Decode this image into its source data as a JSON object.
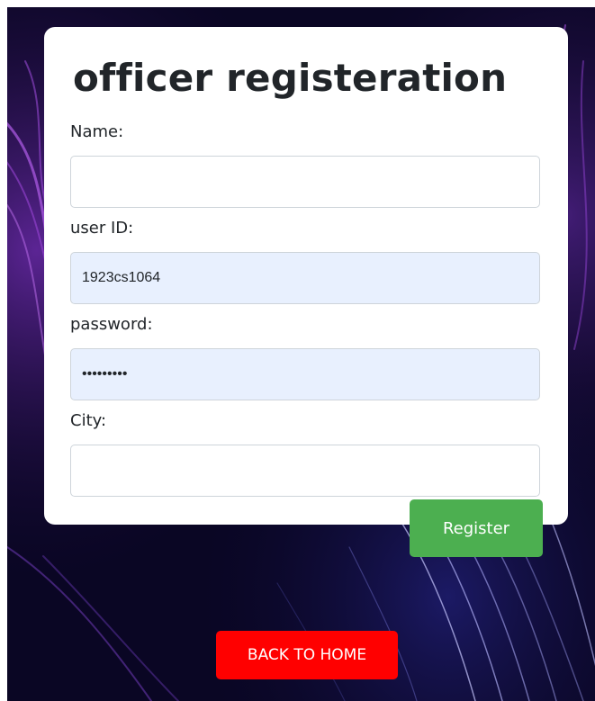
{
  "form": {
    "title": "officer registeration",
    "name_label": "Name:",
    "name_value": "",
    "userid_label": "user ID:",
    "userid_value": "1923cs1064",
    "password_label": "password:",
    "password_value": "abcdefghi",
    "city_label": "City:",
    "city_value": "",
    "register_label": "Register"
  },
  "nav": {
    "back_home_label": "BACK TO HOME"
  },
  "colors": {
    "background": "#0a0624",
    "accent_wave": "#7a2fbf",
    "register_button": "#4caf50",
    "back_home_button": "#ff0000",
    "autofill_field": "#e8f0fe"
  }
}
